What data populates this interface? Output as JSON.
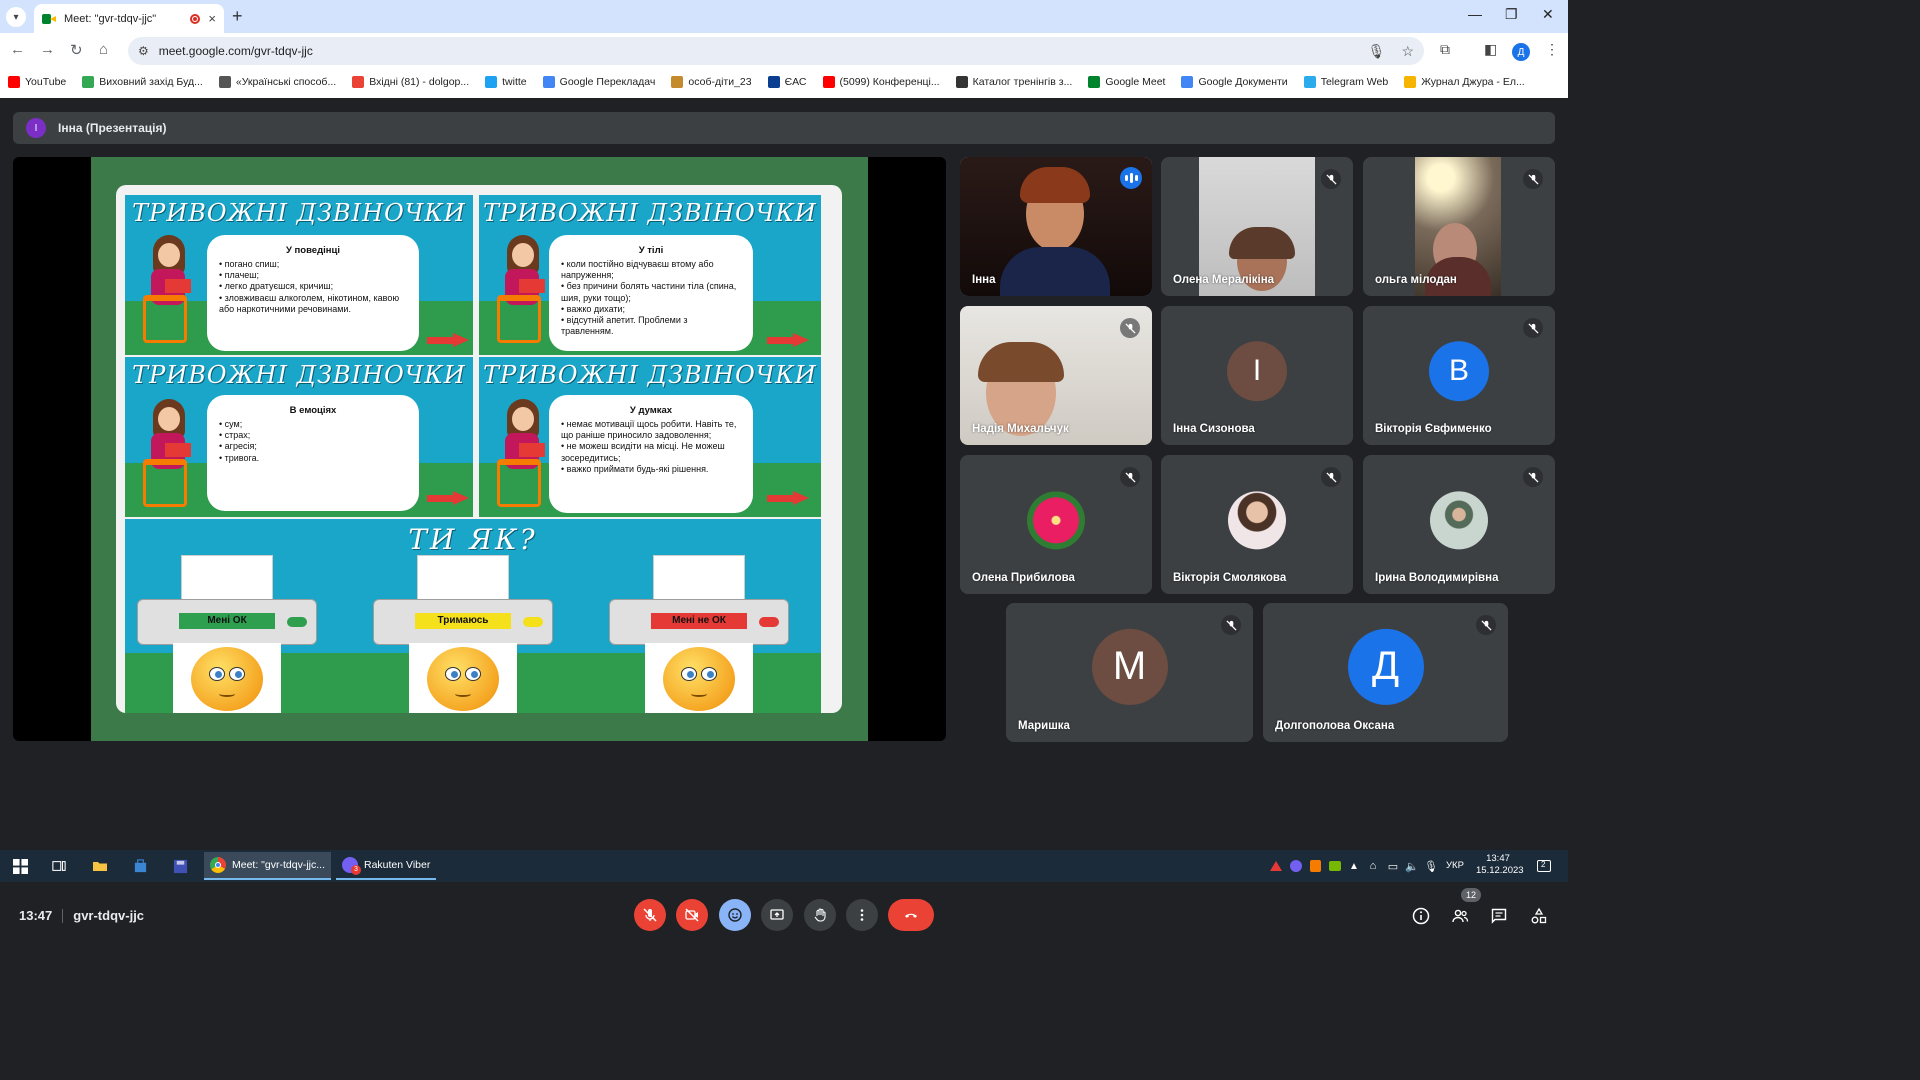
{
  "browser": {
    "tab_title": "Meet: \"gvr-tdqv-jjc\"",
    "tab_close": "×",
    "new_tab": "+",
    "url": "meet.google.com/gvr-tdqv-jjc",
    "profile_initial": "Д",
    "window_controls": [
      "—",
      "❐",
      "✕"
    ],
    "bookmarks": [
      {
        "label": "YouTube",
        "color": "#ff0000"
      },
      {
        "label": "Виховний захід Буд...",
        "color": "#34a853"
      },
      {
        "label": "«Українські способ...",
        "color": "#555555"
      },
      {
        "label": "Вхідні (81) - dolgop...",
        "color": "#ea4335"
      },
      {
        "label": "twitte",
        "color": "#1da1f2"
      },
      {
        "label": "Google Перекладач",
        "color": "#4285f4"
      },
      {
        "label": "особ-діти_23",
        "color": "#c58a2b"
      },
      {
        "label": "ЄАС",
        "color": "#0b3d91"
      },
      {
        "label": "(5099) Конференці...",
        "color": "#ff0000"
      },
      {
        "label": "Каталог тренінгів з...",
        "color": "#333333"
      },
      {
        "label": "Google Meet",
        "color": "#00832d"
      },
      {
        "label": "Google Документи",
        "color": "#4285f4"
      },
      {
        "label": "Telegram Web",
        "color": "#2aabee"
      },
      {
        "label": "Журнал Джура - Ел...",
        "color": "#f6b400"
      }
    ]
  },
  "meet": {
    "presenter_initial": "І",
    "presenter_label": "Інна (Презентація)",
    "slide": {
      "panel_title": "ТРИВОЖНІ ДЗВІНОЧКИ",
      "panels": [
        {
          "heading": "У поведінці",
          "items": [
            "погано спиш;",
            "плачеш;",
            "легко дратуєшся, кричиш;",
            "зловживаєш алкоголем, нікотином, кавою або наркотичними речовинами."
          ]
        },
        {
          "heading": "У тілі",
          "items": [
            "коли постійно відчуваєш втому або напруження;",
            "без причини болять частини тіла (спина, шия, руки тощо);",
            "важко дихати;",
            "відсутній апетит. Проблеми з травленням."
          ]
        },
        {
          "heading": "В емоціях",
          "items": [
            "сум;",
            "страх;",
            "агресія;",
            "тривога."
          ]
        },
        {
          "heading": "У думках",
          "items": [
            "немає мотивації щось робити. Навіть те, що раніше приносило задоволення;",
            "не можеш всидіти на місці. Не можеш зосередитись;",
            "важко приймати будь-які рішення."
          ]
        }
      ],
      "question": "ТИ ЯК?",
      "printers": [
        {
          "label": "Мені ОК",
          "color": "#2e9e4f",
          "led": "#2e9e4f"
        },
        {
          "label": "Тримаюсь",
          "color": "#f4e01b",
          "led": "#f4e01b"
        },
        {
          "label": "Мені не ОК",
          "color": "#e53935",
          "led": "#e53935"
        }
      ]
    },
    "participants": [
      {
        "name": "Інна",
        "type": "video",
        "speaking": true
      },
      {
        "name": "Олена Мералікіна",
        "type": "video",
        "muted": true
      },
      {
        "name": "ольга мілодан",
        "type": "video",
        "muted": true
      },
      {
        "name": "Надія Михальчук",
        "type": "video",
        "muted": true
      },
      {
        "name": "Інна Сизонова",
        "type": "initial",
        "initial": "І",
        "color": "#6d4c41"
      },
      {
        "name": "Вікторія Євфименко",
        "type": "initial",
        "initial": "В",
        "color": "#1a73e8",
        "muted": true
      },
      {
        "name": "Олена Прибилова",
        "type": "photo",
        "muted": true
      },
      {
        "name": "Вікторія Смолякова",
        "type": "photo",
        "muted": true
      },
      {
        "name": "Ірина Володимирівна",
        "type": "photo",
        "muted": true
      },
      {
        "name": "Маришка",
        "type": "initial",
        "initial": "М",
        "color": "#6d4c41",
        "muted": true
      },
      {
        "name": "Долгополова Оксана",
        "type": "initial",
        "initial": "Д",
        "color": "#1a73e8",
        "muted": true
      }
    ],
    "reactions": [
      "💖",
      "👍",
      "🎉",
      "👏",
      "😂",
      "😮",
      "😢",
      "🤔",
      "👎"
    ],
    "time": "13:47",
    "meeting_code": "gvr-tdqv-jjc",
    "participant_count": "12"
  },
  "taskbar": {
    "tasks": [
      {
        "label": "Meet: \"gvr-tdqv-jjc...",
        "active": true
      },
      {
        "label": "Rakuten Viber",
        "active": false
      }
    ],
    "language": "УКР",
    "time": "13:47",
    "date": "15.12.2023",
    "notifications": "2",
    "viber_badge": "3"
  }
}
